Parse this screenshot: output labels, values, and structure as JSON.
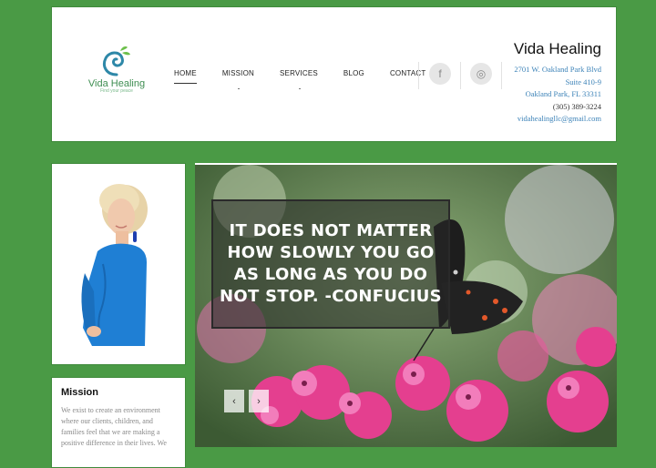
{
  "brand": {
    "logo_title": "Vida Healing",
    "logo_tagline": "Find your peace",
    "site_name": "Vida Healing"
  },
  "nav": {
    "items": [
      {
        "label": "HOME",
        "active": true
      },
      {
        "label": "MISSION"
      },
      {
        "label": "SERVICES"
      },
      {
        "label": "BLOG"
      },
      {
        "label": "CONTACT"
      }
    ]
  },
  "social": {
    "facebook_icon": "f",
    "instagram_icon": "◎"
  },
  "contact": {
    "address1": "2701 W. Oakland Park Blvd",
    "address2": "Suite 410-9",
    "address3": "Oakland Park, FL 33311",
    "phone": "(305) 389-3224",
    "email": "vidahealingllc@gmail.com"
  },
  "mission": {
    "title": "Mission",
    "text": "We exist to create an environment where our clients, children, and families feel that we are making a positive difference in their lives. We"
  },
  "slider": {
    "quote": "IT DOES NOT MATTER HOW SLOWLY YOU GO AS LONG AS YOU DO NOT STOP. -CONFUCIUS",
    "prev_label": "‹",
    "next_label": "›"
  },
  "colors": {
    "page_bg": "#4a9a45",
    "accent_blue": "#3d83b8",
    "dress_blue": "#1f7fd4"
  }
}
